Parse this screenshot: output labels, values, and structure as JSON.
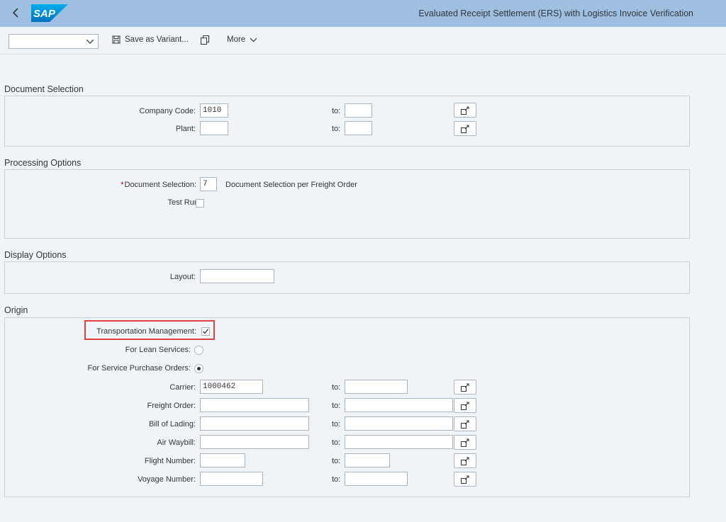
{
  "shell": {
    "logo_text": "SAP",
    "title": "Evaluated Receipt Settlement (ERS) with Logistics Invoice Verification"
  },
  "toolbar": {
    "variant_value": "",
    "save_variant_label": "Save as Variant...",
    "more_label": "More"
  },
  "document_selection": {
    "title": "Document Selection",
    "company_code": {
      "label": "Company Code:",
      "value": "1010",
      "to_label": "to:",
      "to_value": ""
    },
    "plant": {
      "label": "Plant:",
      "value": "",
      "to_label": "to:",
      "to_value": ""
    }
  },
  "processing_options": {
    "title": "Processing Options",
    "document_selection": {
      "required_mark": "*",
      "label": "Document Selection:",
      "value": "7",
      "description": "Document Selection per Freight Order"
    },
    "test_run": {
      "label": "Test Run:",
      "checked": false
    }
  },
  "display_options": {
    "title": "Display Options",
    "layout": {
      "label": "Layout:",
      "value": ""
    }
  },
  "origin": {
    "title": "Origin",
    "transportation_management": {
      "label": "Transportation Management:",
      "checked": true
    },
    "for_lean_services": {
      "label": "For Lean Services:",
      "selected": false
    },
    "for_service_purchase_orders": {
      "label": "For Service Purchase Orders:",
      "selected": true
    },
    "carrier": {
      "label": "Carrier:",
      "value": "1000462",
      "to_label": "to:",
      "to_value": ""
    },
    "freight_order": {
      "label": "Freight Order:",
      "value": "",
      "to_label": "to:",
      "to_value": ""
    },
    "bill_of_lading": {
      "label": "Bill of Lading:",
      "value": "",
      "to_label": "to:",
      "to_value": ""
    },
    "air_waybill": {
      "label": "Air Waybill:",
      "value": "",
      "to_label": "to:",
      "to_value": ""
    },
    "flight_number": {
      "label": "Flight Number:",
      "value": "",
      "to_label": "to:",
      "to_value": ""
    },
    "voyage_number": {
      "label": "Voyage Number:",
      "value": "",
      "to_label": "to:",
      "to_value": ""
    }
  },
  "colors": {
    "shell_bg": "#9ebfe0",
    "page_bg": "#eff4f9",
    "accent": "#0a6ed1",
    "required": "#bb0000",
    "highlight": "#e04040"
  }
}
